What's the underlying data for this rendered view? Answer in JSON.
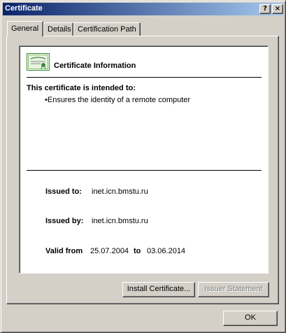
{
  "window": {
    "title": "Certificate",
    "help_button": "?",
    "close_button": "×"
  },
  "tabs": [
    {
      "label": "General",
      "selected": true
    },
    {
      "label": "Details",
      "selected": false
    },
    {
      "label": "Certification Path",
      "selected": false
    }
  ],
  "general": {
    "heading": "Certificate Information",
    "intended_heading": "This certificate is intended to:",
    "purposes": [
      "Ensures the identity of a remote computer"
    ],
    "issued_to_label": "Issued to:",
    "issued_to_value": "inet.icn.bmstu.ru",
    "issued_by_label": "Issued by:",
    "issued_by_value": "inet.icn.bmstu.ru",
    "valid_from_label": "Valid from",
    "valid_from_value": "25.07.2004",
    "valid_to_label": "to",
    "valid_to_value": "03.06.2014",
    "install_button": "Install Certificate...",
    "issuer_statement_button": "Issuer Statement",
    "issuer_statement_enabled": false
  },
  "footer": {
    "ok_button": "OK"
  },
  "colors": {
    "titlebar_start": "#0a246a",
    "titlebar_end": "#a6caf0",
    "face": "#d4d0c8",
    "cert_icon_green": "#3a8a3a"
  },
  "icons": {
    "certificate": "certificate-icon",
    "help": "help-icon",
    "close": "close-icon"
  }
}
